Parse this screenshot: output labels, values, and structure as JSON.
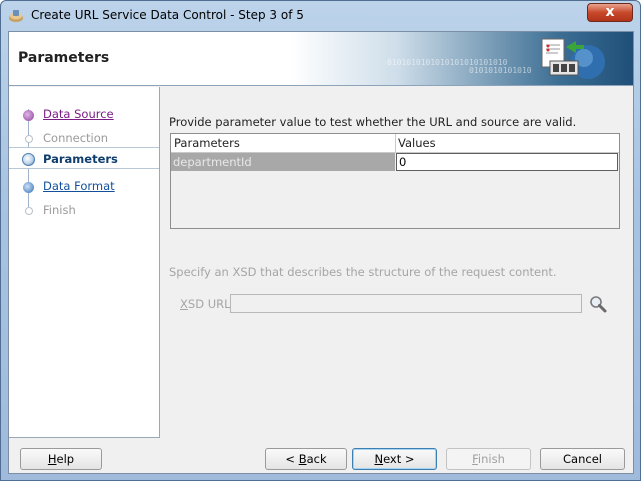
{
  "window": {
    "title": "Create URL Service Data Control  - Step 3 of 5",
    "close_glyph": "x"
  },
  "header": {
    "title": "Parameters",
    "binary_1": "0101010101010101010101010",
    "binary_2": "0101010101010"
  },
  "nav": {
    "items": [
      {
        "label": "Data Source",
        "state": "visited"
      },
      {
        "label": "Connection",
        "state": "disabled"
      },
      {
        "label": "Parameters",
        "state": "current"
      },
      {
        "label": "Data Format",
        "state": "link"
      },
      {
        "label": "Finish",
        "state": "disabled"
      }
    ]
  },
  "main": {
    "instruction": "Provide parameter value to test whether the URL and source are valid.",
    "table": {
      "columns": [
        "Parameters",
        "Values"
      ],
      "rows": [
        {
          "name": "departmentId",
          "value": "0"
        }
      ]
    },
    "xsd": {
      "description": "Specify an XSD that describes the structure of the request content.",
      "label_mnemonic": "X",
      "label_rest": "SD URL:",
      "value": ""
    }
  },
  "footer": {
    "help": {
      "mn": "H",
      "rest": "elp"
    },
    "back": {
      "pre": "< ",
      "mn": "B",
      "rest": "ack"
    },
    "next": {
      "mn": "N",
      "rest": "ext >"
    },
    "finish": {
      "mn": "F",
      "rest": "inish"
    },
    "cancel": "Cancel"
  },
  "icons": [
    "app-icon",
    "close-icon",
    "wizard-banner-icon",
    "search-icon"
  ]
}
